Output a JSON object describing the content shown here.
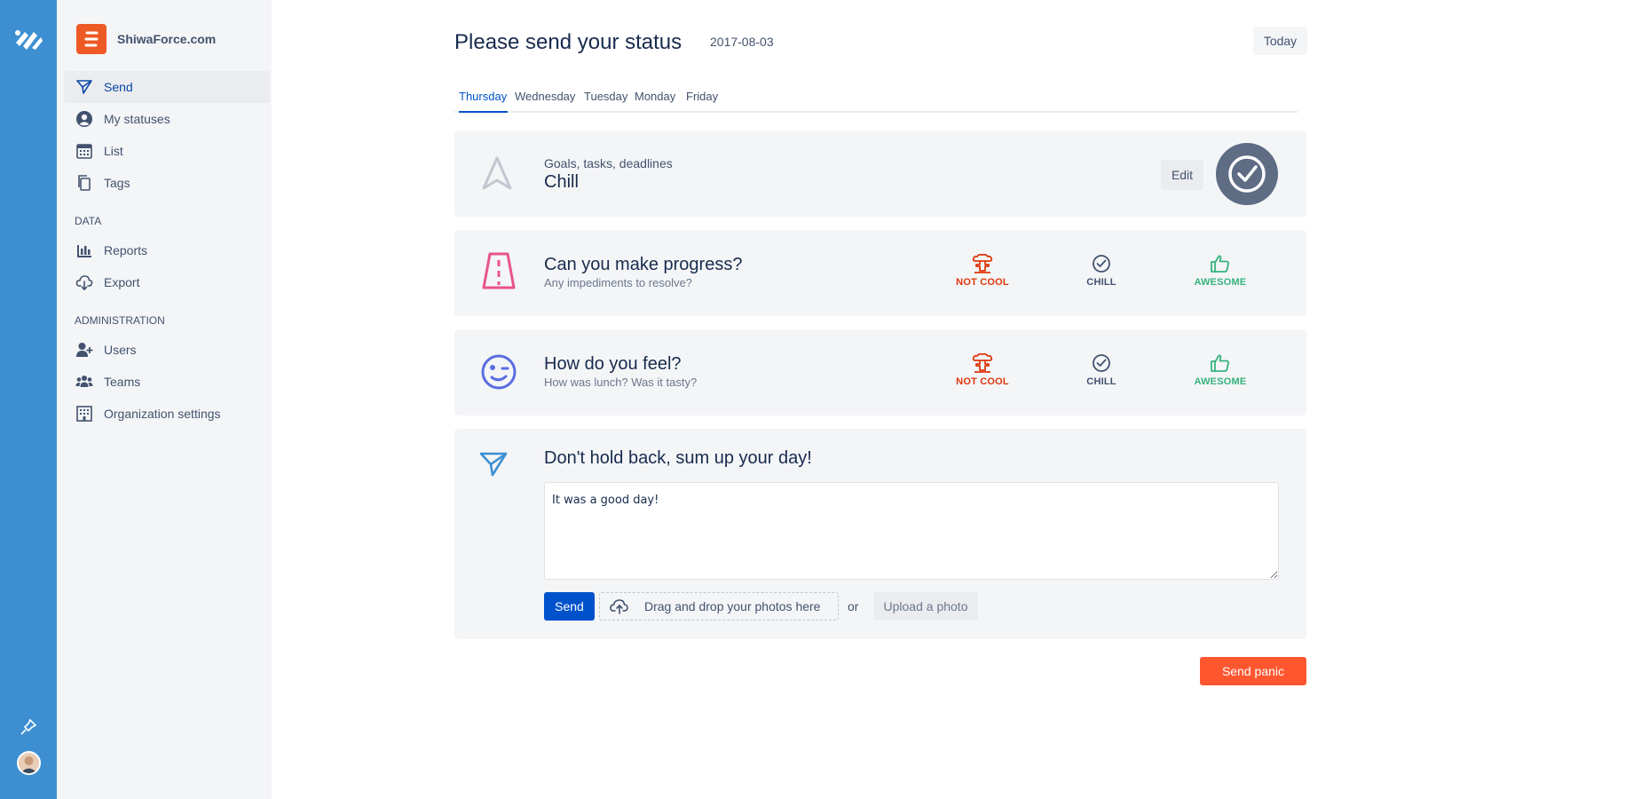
{
  "org": {
    "name": "ShiwaForce.com"
  },
  "sidebar": {
    "items": [
      {
        "label": "Send",
        "icon": "send-icon"
      },
      {
        "label": "My statuses",
        "icon": "user-circle-icon"
      },
      {
        "label": "List",
        "icon": "calendar-icon"
      },
      {
        "label": "Tags",
        "icon": "copy-icon"
      }
    ],
    "data_section": "DATA",
    "data_items": [
      {
        "label": "Reports",
        "icon": "bar-chart-icon"
      },
      {
        "label": "Export",
        "icon": "cloud-download-icon"
      }
    ],
    "admin_section": "ADMINISTRATION",
    "admin_items": [
      {
        "label": "Users",
        "icon": "user-plus-icon"
      },
      {
        "label": "Teams",
        "icon": "users-icon"
      },
      {
        "label": "Organization settings",
        "icon": "building-icon"
      }
    ]
  },
  "header": {
    "title": "Please send your status",
    "date": "2017-08-03",
    "today_label": "Today"
  },
  "tabs": [
    "Thursday",
    "Wednesday",
    "Tuesday",
    "Monday",
    "Friday"
  ],
  "goals_card": {
    "subtitle": "Goals, tasks, deadlines",
    "title": "Chill",
    "edit_label": "Edit"
  },
  "progress_card": {
    "title": "Can you make progress?",
    "subtitle": "Any impediments to resolve?"
  },
  "feel_card": {
    "title": "How do you feel?",
    "subtitle": "How was lunch? Was it tasty?"
  },
  "choices": {
    "bad": "NOT COOL",
    "mid": "CHILL",
    "good": "AWESOME"
  },
  "summary_card": {
    "title": "Don't hold back, sum up your day!",
    "text": "It was a good day!",
    "send_label": "Send",
    "dropzone_label": "Drag and drop your photos here",
    "or_label": "or",
    "upload_label": "Upload a photo"
  },
  "panic_label": "Send panic",
  "colors": {
    "rail": "#3d8fd1",
    "primary": "#0052cc",
    "danger": "#ff5630",
    "good": "#36b37e",
    "bad": "#de350b"
  }
}
